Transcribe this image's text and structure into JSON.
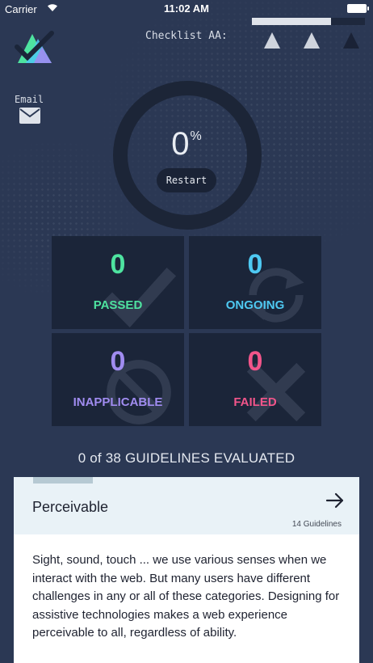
{
  "status_bar": {
    "carrier": "Carrier",
    "time": "11:02 AM"
  },
  "header": {
    "title": "Checklist AA:",
    "progress_fraction": 0.7,
    "levels": [
      "level-a",
      "level-aa",
      "level-aaa"
    ]
  },
  "email": {
    "label": "Email",
    "icon": "envelope-icon"
  },
  "progress": {
    "value": "0",
    "unit": "%",
    "restart_label": "Restart"
  },
  "stats": [
    {
      "count": "0",
      "label": "PASSED",
      "color": "#4ee3a0",
      "icon": "check-icon"
    },
    {
      "count": "0",
      "label": "ONGOING",
      "color": "#4ec9f2",
      "icon": "refresh-icon"
    },
    {
      "count": "0",
      "label": "INAPPLICABLE",
      "color": "#a08cf0",
      "icon": "prohibited-icon"
    },
    {
      "count": "0",
      "label": "FAILED",
      "color": "#f2558a",
      "icon": "cross-icon"
    }
  ],
  "summary": "0 of 38 GUIDELINES EVALUATED",
  "card": {
    "title": "Perceivable",
    "guidelines_count": "14 Guidelines",
    "description": "Sight, sound, touch ... we use various senses when we interact with the web. But many users have different challenges in any or all of these categories. Designing for assistive technologies makes a web experience perceivable to all, regardless of ability."
  },
  "colors": {
    "background": "#2b3854",
    "tile": "#1b2539",
    "card_header": "#e9f2f7"
  }
}
